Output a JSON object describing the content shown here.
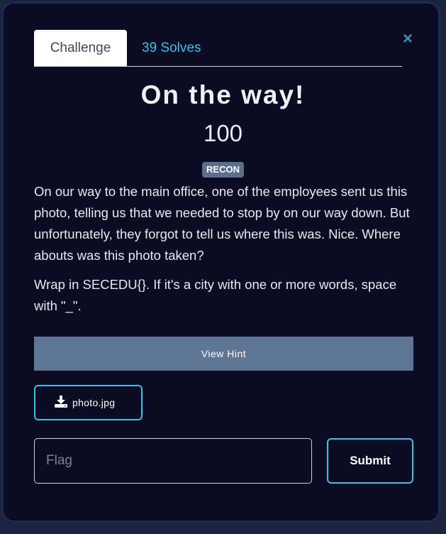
{
  "tabs": {
    "challenge": "Challenge",
    "solves": "39 Solves"
  },
  "close_icon": "×",
  "challenge": {
    "title": "On the way!",
    "points": "100",
    "category": "RECON",
    "description": [
      "On our way to the main office, one of the employees sent us this photo, telling us that we needed to stop by on our way down. But unfortunately, they forgot to tell us where this was. Nice. Where abouts was this photo taken?",
      "Wrap in SECEDU{}. If it's a city with one or more words, space with \"_\"."
    ]
  },
  "hint": {
    "label": "View Hint"
  },
  "file": {
    "icon": "download-icon",
    "name": "photo.jpg"
  },
  "flag_input": {
    "value": "",
    "placeholder": "Flag"
  },
  "submit": {
    "label": "Submit"
  },
  "colors": {
    "background": "#0c0b24",
    "accent": "#35c2ea",
    "tag": "#5b6f8d",
    "hint": "#5f7594"
  }
}
